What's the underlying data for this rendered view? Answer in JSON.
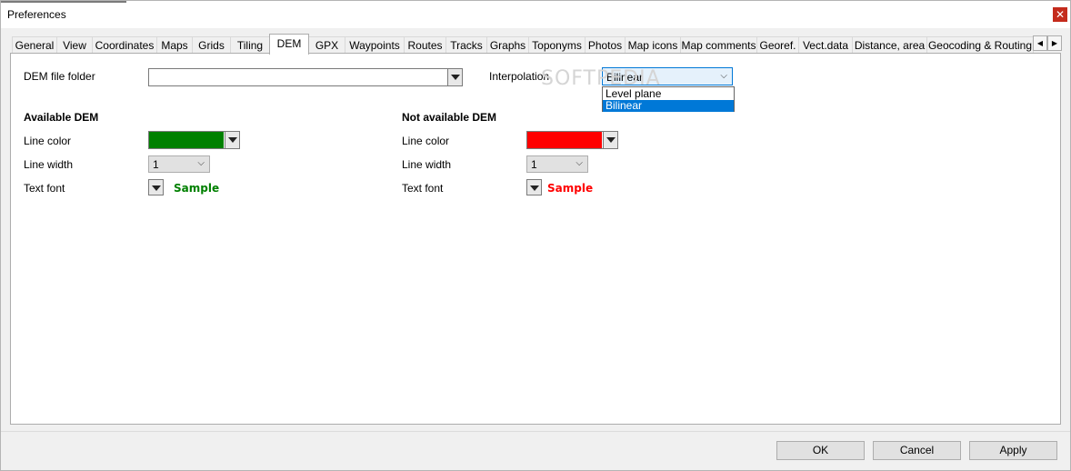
{
  "window": {
    "title": "Preferences",
    "close_glyph": "✕"
  },
  "tabs": [
    {
      "label": "General"
    },
    {
      "label": "View"
    },
    {
      "label": "Coordinates"
    },
    {
      "label": "Maps"
    },
    {
      "label": "Grids"
    },
    {
      "label": "Tiling"
    },
    {
      "label": "DEM"
    },
    {
      "label": "GPX"
    },
    {
      "label": "Waypoints"
    },
    {
      "label": "Routes"
    },
    {
      "label": "Tracks"
    },
    {
      "label": "Graphs"
    },
    {
      "label": "Toponyms"
    },
    {
      "label": "Photos"
    },
    {
      "label": "Map icons"
    },
    {
      "label": "Map comments"
    },
    {
      "label": "Georef."
    },
    {
      "label": "Vect.data"
    },
    {
      "label": "Distance, area"
    },
    {
      "label": "Geocoding & Routing"
    }
  ],
  "active_tab": "DEM",
  "tab_scroll": {
    "left_glyph": "◀",
    "right_glyph": "▶"
  },
  "dem": {
    "folder_label": "DEM file folder",
    "folder_value": "",
    "interpolation_label": "Interpolation",
    "interpolation_value": "Bilinear",
    "interpolation_options": [
      "Level plane",
      "Bilinear"
    ],
    "interpolation_selected": "Bilinear",
    "available": {
      "header": "Available DEM",
      "line_color_label": "Line color",
      "line_color": "#008000",
      "line_width_label": "Line width",
      "line_width": "1",
      "text_font_label": "Text font",
      "sample": "Sample"
    },
    "not_available": {
      "header": "Not available DEM",
      "line_color_label": "Line color",
      "line_color": "#ff0000",
      "line_width_label": "Line width",
      "line_width": "1",
      "text_font_label": "Text font",
      "sample": "Sample"
    }
  },
  "watermark": "SOFTPEDIA",
  "buttons": {
    "ok": "OK",
    "cancel": "Cancel",
    "apply": "Apply"
  },
  "colors": {
    "accent": "#0078d7",
    "close": "#c42b1c",
    "available": "#008000",
    "not_available": "#ff0000"
  },
  "icons": {
    "chevron": "⌵"
  }
}
